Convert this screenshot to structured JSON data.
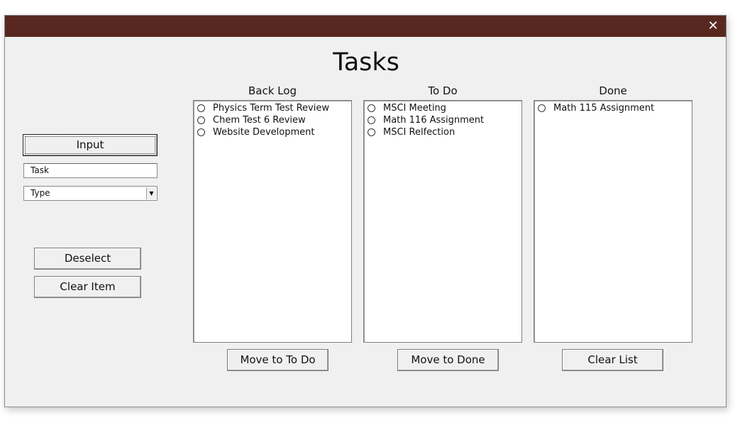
{
  "window": {
    "close_glyph": "✕"
  },
  "title": "Tasks",
  "left_panel": {
    "input_button": "Input",
    "task_field_value": "Task",
    "type_select_value": "Type",
    "type_select_arrow": "▼",
    "deselect_button": "Deselect",
    "clear_item_button": "Clear Item"
  },
  "columns": {
    "backlog": {
      "label": "Back Log",
      "items": [
        "Physics Term Test Review",
        "Chem Test 6 Review",
        "Website Development"
      ],
      "button": "Move to To Do"
    },
    "todo": {
      "label": "To Do",
      "items": [
        "MSCI Meeting",
        "Math 116 Assignment",
        "MSCI Relfection"
      ],
      "button": "Move to Done"
    },
    "done": {
      "label": "Done",
      "items": [
        "Math 115 Assignment"
      ],
      "button": "Clear List"
    }
  },
  "colors": {
    "titlebar": "#582820",
    "window_bg": "#f0f0f0"
  }
}
